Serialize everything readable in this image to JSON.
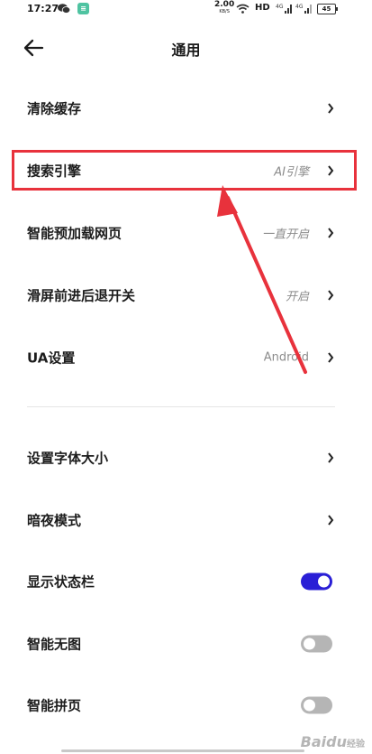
{
  "status_bar": {
    "time": "17:27",
    "speed": "2.00",
    "speed_unit": "KB/S",
    "hd": "HD",
    "network_1": "4G",
    "network_2": "4G",
    "battery": "45",
    "icons": [
      "wechat-icon",
      "app-icon",
      "wifi-icon",
      "signal-icon",
      "battery-icon"
    ]
  },
  "header": {
    "title": "通用",
    "back_icon": "arrow-left-icon"
  },
  "settings": [
    {
      "label": "清除缓存",
      "value": ""
    },
    {
      "label": "搜索引擎",
      "value": "AI引擎"
    },
    {
      "label": "智能预加载网页",
      "value": "一直开启"
    },
    {
      "label": "滑屏前进后退开关",
      "value": "开启"
    },
    {
      "label": "UA设置",
      "value": "Android"
    },
    {
      "label": "设置字体大小",
      "value": ""
    },
    {
      "label": "暗夜模式",
      "value": ""
    }
  ],
  "toggles": [
    {
      "label": "显示状态栏",
      "on": true
    },
    {
      "label": "智能无图",
      "on": false
    },
    {
      "label": "智能拼页",
      "on": false
    }
  ],
  "watermark": {
    "text": "Baidu",
    "sub": "经验"
  },
  "colors": {
    "accent": "#2a1fd6",
    "highlight": "#e8323c",
    "toggle_off": "#b5b5b5",
    "value_text": "#8c8c8c"
  }
}
